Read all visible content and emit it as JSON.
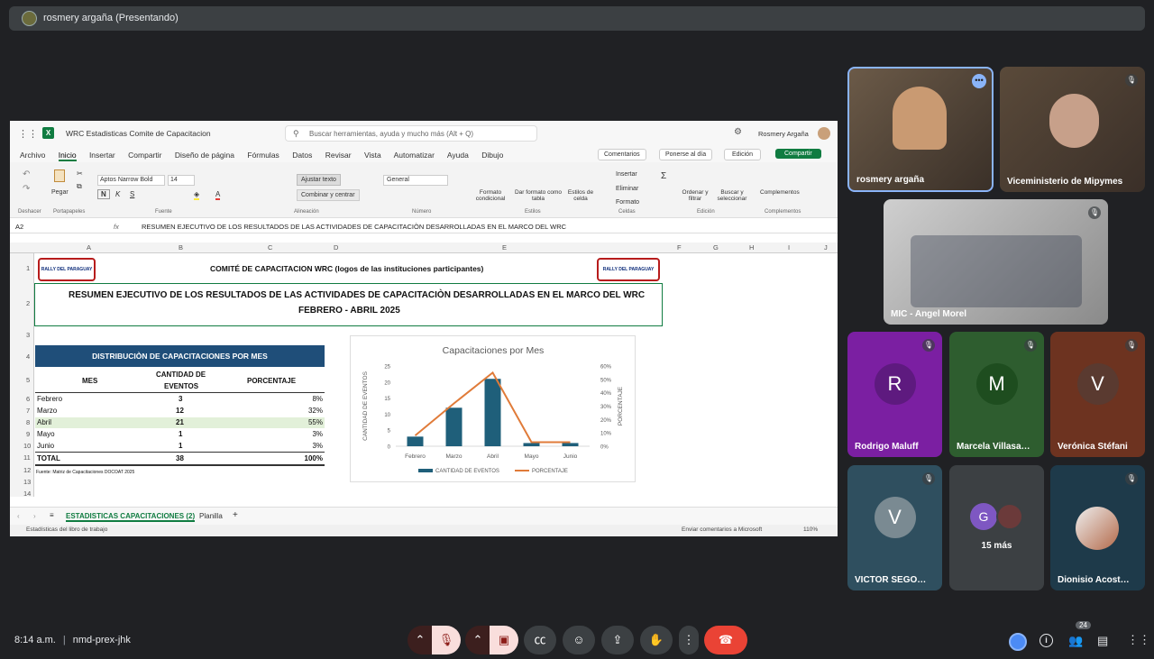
{
  "meeting": {
    "presenter_label": "rosmery argaña (Presentando)",
    "time": "8:14 a.m.",
    "code": "nmd-prex-jhk",
    "participant_count": "24"
  },
  "excel": {
    "file_title": "WRC Estadisticas Comite de Capacitacion",
    "search_placeholder": "Buscar herramientas, ayuda y mucho más (Alt + Q)",
    "user": "Rosmery Argaña",
    "tabs": [
      "Archivo",
      "Inicio",
      "Insertar",
      "Compartir",
      "Diseño de página",
      "Fórmulas",
      "Datos",
      "Revisar",
      "Vista",
      "Automatizar",
      "Ayuda",
      "Dibujo"
    ],
    "btn_comments": "Comentarios",
    "btn_catch_up": "Ponerse al día",
    "btn_edit": "Edición",
    "btn_share": "Compartir",
    "ribbon": {
      "undo_group": "Deshacer",
      "paste": "Pegar",
      "clipboard": "Portapapeles",
      "font_name": "Aptos Narrow Bold",
      "font_size": "14",
      "font_group": "Fuente",
      "wrap_text": "Ajustar texto",
      "merge": "Combinar y centrar",
      "align_group": "Alineación",
      "number_format": "General",
      "number_group": "Número",
      "cond_format": "Formato condicional",
      "table_format": "Dar formato como tabla",
      "cell_styles": "Estilos de celda",
      "styles_group": "Estilos",
      "insert": "Insertar",
      "delete": "Eliminar",
      "format": "Formato",
      "cells_group": "Celdas",
      "sort": "Ordenar y filtrar",
      "find": "Buscar y seleccionar",
      "edit_group": "Edición",
      "addins": "Complementos",
      "addins_group": "Complementos"
    },
    "name_box": "A2",
    "formula": "RESUMEN EJECUTIVO DE LOS RESULTADOS DE LAS ACTIVIDADES DE CAPACITACIÒN DESARROLLADAS EN EL MARCO DEL WRC",
    "columns": [
      "A",
      "B",
      "C",
      "D",
      "E",
      "F",
      "G",
      "H",
      "I",
      "J"
    ],
    "rows": [
      "1",
      "2",
      "3",
      "4",
      "5",
      "6",
      "7",
      "8",
      "9",
      "10",
      "11",
      "12",
      "13",
      "14"
    ],
    "logo_text": "RALLY DEL PARAGUAY",
    "header_title": "COMITÉ DE CAPACITACION WRC (logos de las instituciones participantes)",
    "summary_line1": "RESUMEN EJECUTIVO DE LOS RESULTADOS DE LAS ACTIVIDADES DE CAPACITACIÒN DESARROLLADAS EN EL MARCO DEL WRC",
    "summary_line2": "FEBRERO - ABRIL 2025",
    "table_title": "DISTRIBUCIÒN DE CAPACITACIONES POR MES",
    "col_mes": "MES",
    "col_cant_1": "CANTIDAD DE",
    "col_cant_2": "EVENTOS",
    "col_pct": "PORCENTAJE",
    "table_rows": [
      {
        "mes": "Febrero",
        "cant": "3",
        "pct": "8%"
      },
      {
        "mes": "Marzo",
        "cant": "12",
        "pct": "32%"
      },
      {
        "mes": "Abril",
        "cant": "21",
        "pct": "55%"
      },
      {
        "mes": "Mayo",
        "cant": "1",
        "pct": "3%"
      },
      {
        "mes": "Junio",
        "cant": "1",
        "pct": "3%"
      }
    ],
    "total_label": "TOTAL",
    "total_cant": "38",
    "total_pct": "100%",
    "source_note": "Fuente: Matriz de Capacitaciones DOCOAT 2025",
    "sheet_active": "ESTADISTICAS CAPACITACIONES (2)",
    "sheet_other": "Planilla",
    "status_left": "Estadísticas del libro de trabajo",
    "status_feedback": "Enviar comentarios a Microsoft",
    "zoom": "110%"
  },
  "chart_data": {
    "type": "bar",
    "title": "Capacitaciones por Mes",
    "categories": [
      "Febrero",
      "Marzo",
      "Abril",
      "Mayo",
      "Junio"
    ],
    "ylabel": "CANTIDAD DE EVENTOS",
    "y2label": "PORCENTAJE",
    "ylim": [
      0,
      25
    ],
    "y2lim": [
      0,
      60
    ],
    "yticks": [
      "0",
      "5",
      "10",
      "15",
      "20",
      "25"
    ],
    "y2ticks": [
      "0%",
      "10%",
      "20%",
      "30%",
      "40%",
      "50%",
      "60%"
    ],
    "series": [
      {
        "name": "CANTIDAD DE EVENTOS",
        "type": "bar",
        "values": [
          3,
          12,
          21,
          1,
          1
        ],
        "color": "#1f5f7a"
      },
      {
        "name": "PORCENTAJE",
        "type": "line",
        "axis": "y2",
        "values": [
          8,
          32,
          55,
          3,
          3
        ],
        "color": "#e07b39"
      }
    ],
    "legend": "bottom"
  },
  "participants": [
    {
      "name": "rosmery argaña",
      "type": "video",
      "color": "#5a4a3a"
    },
    {
      "name": "Viceministerio de Mipymes",
      "type": "video",
      "color": "#4a3f35"
    },
    {
      "name": "MIC - Angel Morel",
      "type": "video",
      "color": "#8a8a8a"
    },
    {
      "name": "Rodrigo Maluff",
      "initial": "R",
      "bg": "#7b1fa2",
      "av": "#5e1a7f"
    },
    {
      "name": "Marcela Villasa…",
      "initial": "M",
      "bg": "#2e5d2f",
      "av": "#1e4d1f"
    },
    {
      "name": "Verónica Stéfani",
      "initial": "V",
      "bg": "#6d3320",
      "av": "#5a3a30"
    },
    {
      "name": "VICTOR SEGO…",
      "initial": "V",
      "bg": "#2f4f5f",
      "av": "#7a8a92"
    },
    {
      "name": "Dionisio Acost…",
      "type": "photo",
      "bg": "#1e3a4a"
    }
  ],
  "more": {
    "initial": "G",
    "label": "15 más"
  }
}
